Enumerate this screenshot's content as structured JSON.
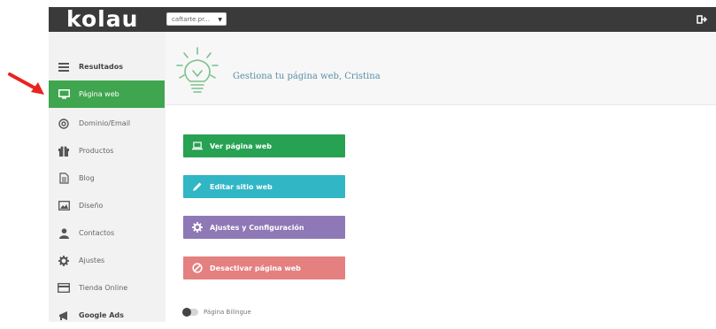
{
  "topbar": {
    "logo": "kolau",
    "site_select": "caftarte.pr...",
    "logout_icon": "logout-icon"
  },
  "sidebar": {
    "items": [
      {
        "label": "Resultados",
        "icon": "menu-icon"
      },
      {
        "label": "Página web",
        "icon": "monitor-icon",
        "active": true
      },
      {
        "label": "Dominio/Email",
        "icon": "at-icon"
      },
      {
        "label": "Productos",
        "icon": "gift-icon"
      },
      {
        "label": "Blog",
        "icon": "document-icon"
      },
      {
        "label": "Diseño",
        "icon": "image-icon"
      },
      {
        "label": "Contactos",
        "icon": "user-icon"
      },
      {
        "label": "Ajustes",
        "icon": "gear-icon"
      },
      {
        "label": "Tienda Online",
        "icon": "card-icon"
      },
      {
        "label": "Google Ads",
        "icon": "megaphone-icon"
      }
    ]
  },
  "header": {
    "title": "Gestiona tu página web, Cristina"
  },
  "actions": {
    "view_site": "Ver página web",
    "edit_site": "Editar sitio web",
    "settings": "Ajustes y Configuración",
    "deactivate": "Desactivar página web"
  },
  "toggle": {
    "label": "Página Bilingue"
  },
  "colors": {
    "active_nav": "#3fa64f",
    "view_button": "#27a152",
    "edit_button": "#31b6c6",
    "settings_button": "#8f78b6",
    "deactivate_button": "#e48080",
    "annotation_arrow": "#e8231f"
  }
}
